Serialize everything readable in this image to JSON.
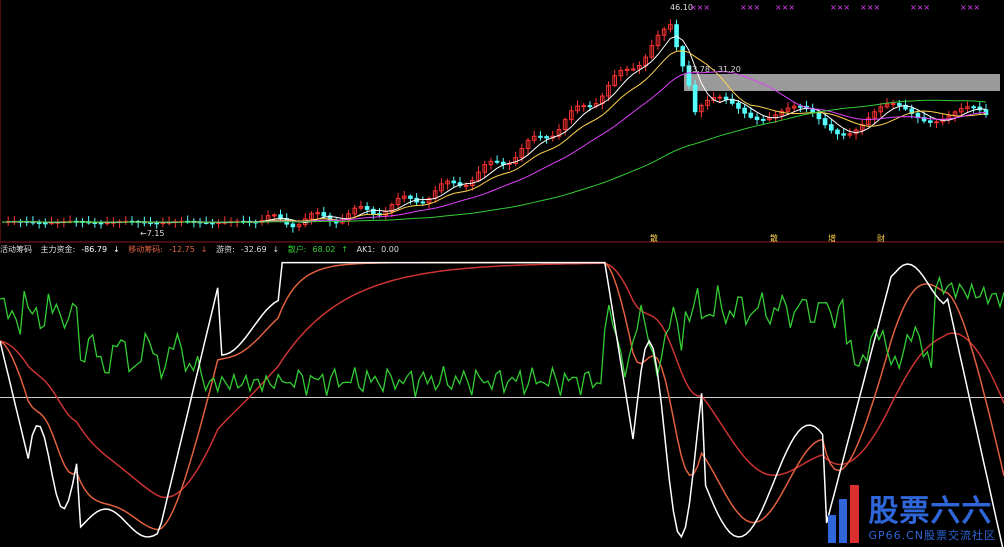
{
  "chart_data": [
    {
      "type": "candlestick",
      "annotations": {
        "high_label": "46.10",
        "low_label": "7.15",
        "range_label": "33.78 - 31.20"
      },
      "colors": {
        "up": "#ff3333",
        "down": "#54ffff",
        "ma5": "#ffffff",
        "ma10": "#ffd24d",
        "ma20": "#e040fb",
        "ma60": "#33cc33",
        "band": "#9a9a9a"
      },
      "event_markers": [
        "散",
        "散",
        "增",
        "财"
      ],
      "top_marks": "×××××"
    },
    {
      "type": "line",
      "series": [
        {
          "name": "主力资金",
          "color": "#ffffff",
          "last": -86.79
        },
        {
          "name": "移动筹码",
          "color": "#e06040",
          "last": -12.75
        },
        {
          "name": "游资",
          "color": "#cc3333",
          "last": -32.69
        },
        {
          "name": "散户",
          "color": "#33cc33",
          "last": 68.02
        },
        {
          "name": "AK1",
          "color": "#bbbbbb",
          "last": 0.0
        }
      ]
    }
  ],
  "info": {
    "title": "活动筹码",
    "label_main": "主力资金:",
    "val_main": "-86.79",
    "label_move": "移动筹码:",
    "val_move": "-12.75",
    "label_hot": "游资:",
    "val_hot": "-32.69",
    "label_retail": "散户:",
    "val_retail": "68.02",
    "label_ak": "AK1:",
    "val_ak": "0.00",
    "arrow_down": "↓",
    "arrow_up": "↑"
  },
  "watermark": {
    "main": "股票六六",
    "sub": "GP66.CN股票交流社区"
  }
}
